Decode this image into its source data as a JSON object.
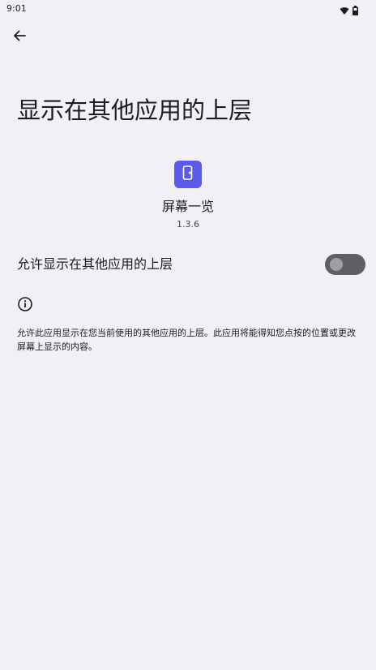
{
  "status_bar": {
    "time": "9:01",
    "icons": [
      "wifi-icon",
      "battery-icon"
    ]
  },
  "header": {
    "back_icon": "arrow-left-icon"
  },
  "page": {
    "title": "显示在其他应用的上层"
  },
  "app": {
    "icon": "phone-sparkle-icon",
    "icon_color": "#5b5bea",
    "name": "屏幕一览",
    "version": "1.3.6"
  },
  "setting": {
    "label": "允许显示在其他应用的上层",
    "enabled": false
  },
  "info": {
    "icon": "info-icon",
    "description": "允许此应用显示在您当前使用的其他应用的上层。此应用将能得知您点按的位置或更改屏幕上显示的内容。"
  }
}
